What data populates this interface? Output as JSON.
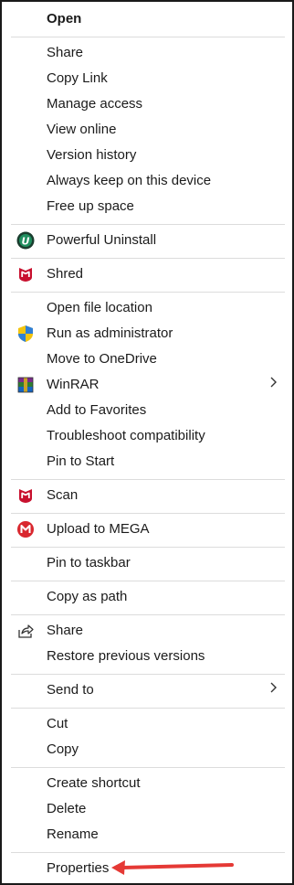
{
  "menu": {
    "open": "Open",
    "share": "Share",
    "copy_link": "Copy Link",
    "manage_access": "Manage access",
    "view_online": "View online",
    "version_history": "Version history",
    "always_keep": "Always keep on this device",
    "free_up_space": "Free up space",
    "powerful_uninstall": "Powerful Uninstall",
    "shred": "Shred",
    "open_file_location": "Open file location",
    "run_as_admin": "Run as administrator",
    "move_to_onedrive": "Move to OneDrive",
    "winrar": "WinRAR",
    "add_to_favorites": "Add to Favorites",
    "troubleshoot": "Troubleshoot compatibility",
    "pin_to_start": "Pin to Start",
    "scan": "Scan",
    "upload_mega": "Upload to MEGA",
    "pin_taskbar": "Pin to taskbar",
    "copy_as_path": "Copy as path",
    "share2": "Share",
    "restore_prev": "Restore previous versions",
    "send_to": "Send to",
    "cut": "Cut",
    "copy": "Copy",
    "create_shortcut": "Create shortcut",
    "delete": "Delete",
    "rename": "Rename",
    "properties": "Properties"
  },
  "icons": {
    "uninstall": "powerful-uninstall-icon",
    "mcafee": "mcafee-shred-icon",
    "shield": "uac-shield-icon",
    "winrar": "winrar-icon",
    "mega": "mega-icon",
    "share": "share-icon",
    "submenu": "chevron-right-icon"
  },
  "colors": {
    "mcafee_red": "#c8102e",
    "mega_red": "#d9272e",
    "uninstall_green": "#1f8f5f",
    "annotation_arrow": "#e53935"
  }
}
